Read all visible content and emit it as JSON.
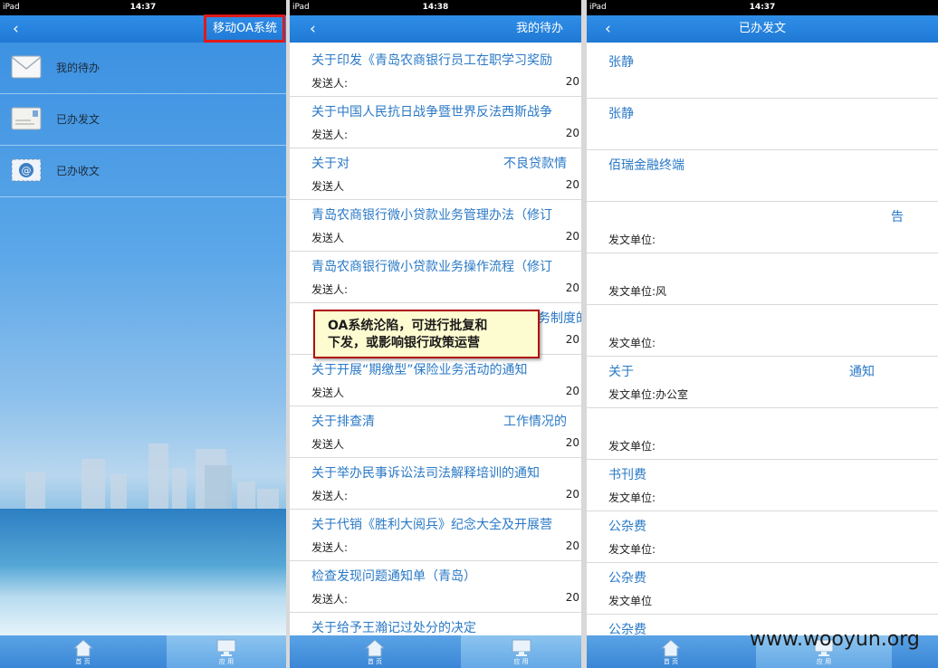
{
  "colors": {
    "navbar": "#2585e0",
    "link_text": "#2a79c6",
    "highlight_red": "#e01919",
    "callout_bg": "#fdfbd0"
  },
  "panel1": {
    "status": {
      "carrier": "iPad",
      "time": "14:37"
    },
    "nav": {
      "back_icon": "chevron-left-icon",
      "title": "移动OA系统"
    },
    "menu": [
      {
        "label": "我的待办",
        "icon": "envelope-icon"
      },
      {
        "label": "已办发文",
        "icon": "letter-icon"
      },
      {
        "label": "已办收文",
        "icon": "at-mail-icon"
      }
    ],
    "tabs": [
      {
        "label": "首 页",
        "icon": "home-icon"
      },
      {
        "label": "应 用",
        "icon": "monitor-icon"
      }
    ]
  },
  "panel2": {
    "status": {
      "carrier": "iPad",
      "time": "14:38"
    },
    "nav": {
      "title": "我的待办"
    },
    "rows": [
      {
        "title": "关于印发《青岛农商银行员工在职学习奖励",
        "sub": "发送人:",
        "date": "20"
      },
      {
        "title": "关于中国人民抗日战争暨世界反法西斯战争",
        "sub": "发送人:",
        "date": "20"
      },
      {
        "title": "关于对",
        "title2": "不良贷款情",
        "sub": "发送人",
        "date": "20"
      },
      {
        "title": "青岛农商银行微小贷款业务管理办法（修订",
        "sub": "发送人",
        "date": "20"
      },
      {
        "title": "青岛农商银行微小贷款业务操作流程（修订",
        "sub": "发送人:",
        "date": "20"
      },
      {
        "title": "",
        "title2": "务制度的",
        "sub": "",
        "date": "20"
      },
      {
        "title": "关于开展“期缴型”保险业务活动的通知",
        "sub": "发送人",
        "date": "20"
      },
      {
        "title": "关于排查清",
        "title2": "工作情况的",
        "sub": "发送人",
        "date": "20"
      },
      {
        "title": "关于举办民事诉讼法司法解释培训的通知",
        "sub": "发送人:",
        "date": "20"
      },
      {
        "title": "关于代销《胜利大阅兵》纪念大全及开展营",
        "sub": "发送人:",
        "date": "20"
      },
      {
        "title": "检查发现问题通知单（青岛）",
        "sub": "发送人:",
        "date": "20"
      },
      {
        "title": "关于给予王瀚记过处分的决定",
        "sub": "",
        "date": ""
      }
    ],
    "callout": {
      "line1": "OA系统沦陷，可进行批复和",
      "line2": "下发，或影响银行政策运营"
    },
    "tabs": [
      {
        "label": "首 页",
        "icon": "home-icon"
      },
      {
        "label": "应 用",
        "icon": "monitor-icon"
      }
    ]
  },
  "panel3": {
    "status": {
      "carrier": "iPad",
      "time": "14:37"
    },
    "nav": {
      "title": "已办发文"
    },
    "rows": [
      {
        "title": "张静",
        "sub": ""
      },
      {
        "title": "张静",
        "sub": ""
      },
      {
        "title": "佰瑞金融终端",
        "sub": ""
      },
      {
        "title": "告",
        "sub": "发文单位:"
      },
      {
        "title": "",
        "sub": "发文单位:风"
      },
      {
        "title": "",
        "sub": "发文单位:"
      },
      {
        "title": "关于",
        "title2": "通知",
        "sub": "发文单位:办公室"
      },
      {
        "title": "",
        "sub": "发文单位:"
      },
      {
        "title": "书刊费",
        "sub": "发文单位:"
      },
      {
        "title": "公杂费",
        "sub": "发文单位:"
      },
      {
        "title": "公杂费",
        "sub": "发文单位"
      },
      {
        "title": "公杂费",
        "sub": ""
      }
    ],
    "tabs": [
      {
        "label": "首 页",
        "icon": "home-icon"
      },
      {
        "label": "应 用",
        "icon": "monitor-icon"
      }
    ]
  },
  "watermark": "www.wooyun.org"
}
